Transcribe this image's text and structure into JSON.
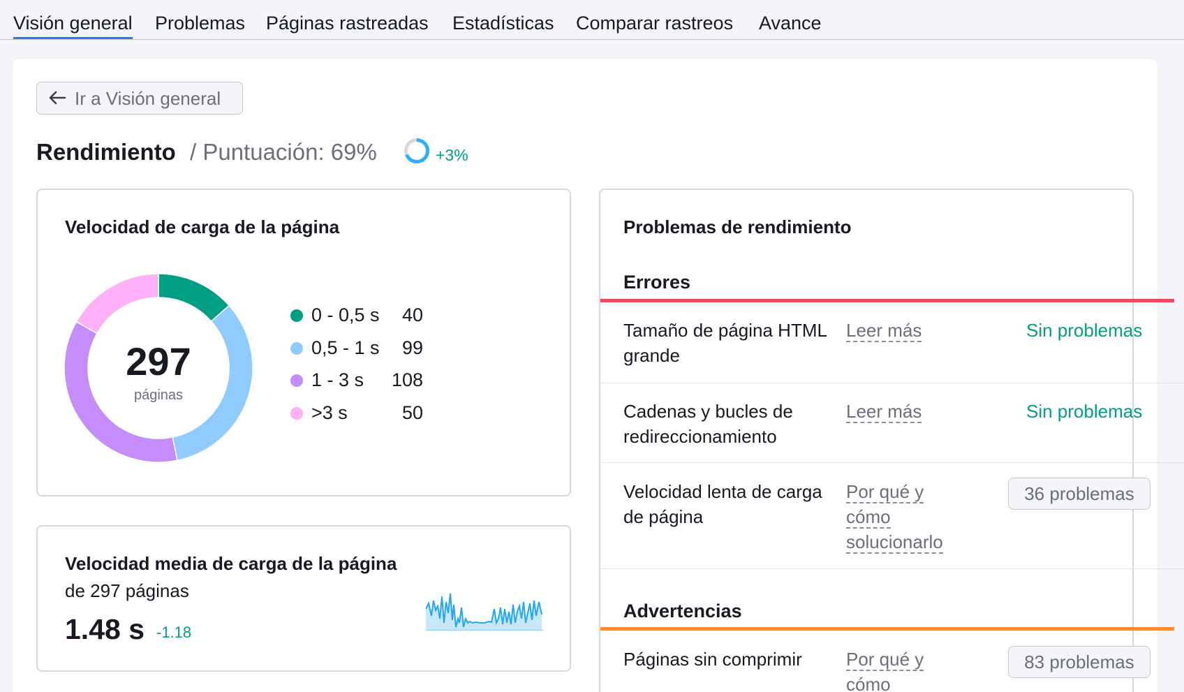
{
  "tabs": [
    {
      "label": "Visión general",
      "active": true
    },
    {
      "label": "Problemas"
    },
    {
      "label": "Páginas rastreadas"
    },
    {
      "label": "Estadísticas"
    },
    {
      "label": "Comparar rastreos"
    },
    {
      "label": "Avance"
    }
  ],
  "back_button": {
    "label": "Ir a Visión general",
    "icon": "arrow-left-icon"
  },
  "header": {
    "title": "Rendimiento",
    "score_label": "/ Puntuación: 69%",
    "score_percent": 69,
    "score_delta": "+3%"
  },
  "colors": {
    "accent": "#2a7de1",
    "green": "#009f81",
    "error": "#f0475a",
    "warning": "#ff8c3b",
    "seg_0": "#009f81",
    "seg_1": "#8fcbff",
    "seg_2": "#c58dfb",
    "seg_3": "#ffb0f7"
  },
  "load_speed": {
    "title": "Velocidad de carga de la página",
    "total": "297",
    "total_label": "páginas",
    "legend": [
      {
        "range": "0 - 0,5 s",
        "value": "40",
        "count": 40
      },
      {
        "range": "0,5 - 1 s",
        "value": "99",
        "count": 99
      },
      {
        "range": "1 - 3 s",
        "value": "108",
        "count": 108
      },
      {
        "range": ">3 s",
        "value": "50",
        "count": 50
      }
    ]
  },
  "avg_speed": {
    "title": "Velocidad media de carga de la página",
    "subtitle": "de 297 páginas",
    "value": "1.48 s",
    "delta": "-1.18"
  },
  "issues": {
    "title": "Problemas de rendimiento",
    "errors_label": "Errores",
    "warnings_label": "Advertencias",
    "errors": [
      {
        "name": "Tamaño de página HTML grande",
        "link": "Leer más",
        "status": "Sin problemas"
      },
      {
        "name": "Cadenas y bucles de redireccionamiento",
        "link": "Leer más",
        "status": "Sin problemas"
      },
      {
        "name": "Velocidad lenta de carga de página",
        "link": "Por qué y cómo solucionarlo",
        "status": "36 problemas"
      }
    ],
    "warnings": [
      {
        "name": "Páginas sin comprimir",
        "link": "Por qué y cómo",
        "status": "83 problemas"
      }
    ]
  }
}
